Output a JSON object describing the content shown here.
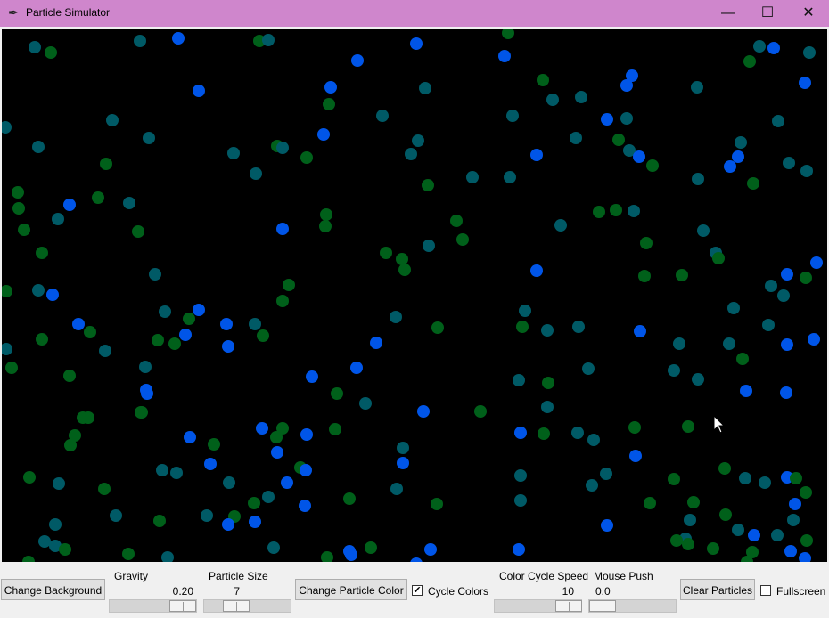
{
  "window": {
    "title": "Particle Simulator",
    "icon": "feather-icon",
    "controls": {
      "minimize": "—",
      "maximize": "☐",
      "close": "✕"
    },
    "title_bar_color": "#cf86cc"
  },
  "canvas": {
    "background": "#000000",
    "particle_colors": [
      "#0055e8",
      "#005a66",
      "#00601a"
    ]
  },
  "controls": {
    "change_background": "Change Background",
    "gravity": {
      "label": "Gravity",
      "value": "0.20"
    },
    "particle_size": {
      "label": "Particle Size",
      "value": "7"
    },
    "change_particle_color": "Change Particle Color",
    "cycle_colors": {
      "label": "Cycle Colors",
      "checked": true,
      "mark": "✔"
    },
    "color_cycle_speed": {
      "label": "Color Cycle Speed",
      "value": "10"
    },
    "mouse_push": {
      "label": "Mouse Push",
      "value": "0.0"
    },
    "clear_particles": "Clear Particles",
    "fullscreen": {
      "label": "Fullscreen",
      "checked": false
    }
  }
}
